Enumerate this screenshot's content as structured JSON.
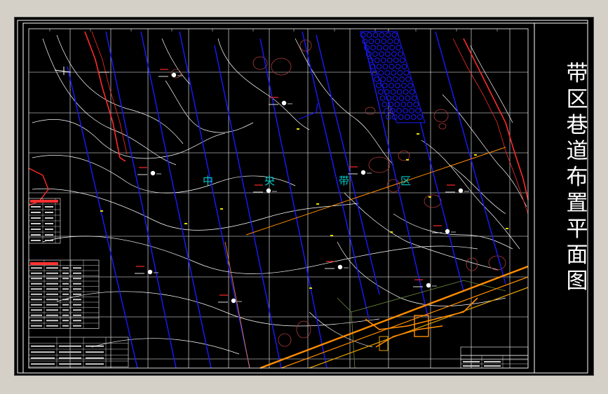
{
  "drawing": {
    "title": "带区巷道布置平面图",
    "title_chars": [
      "带",
      "区",
      "巷",
      "道",
      "布",
      "置",
      "平",
      "面",
      "图"
    ],
    "zone_label_chars": [
      "中",
      "央",
      "带",
      "区"
    ],
    "colors": {
      "background": "#000000",
      "frame": "#ffffff",
      "grid": "#ffffff",
      "contour": "#ffffff",
      "roadway": "#1a1aff",
      "fault": "#ff2a2a",
      "orange": "#ff8c00",
      "zone_label": "#00c8c8",
      "symbol": "#b03a3a",
      "goaf_pattern": "#1a1aff"
    }
  }
}
